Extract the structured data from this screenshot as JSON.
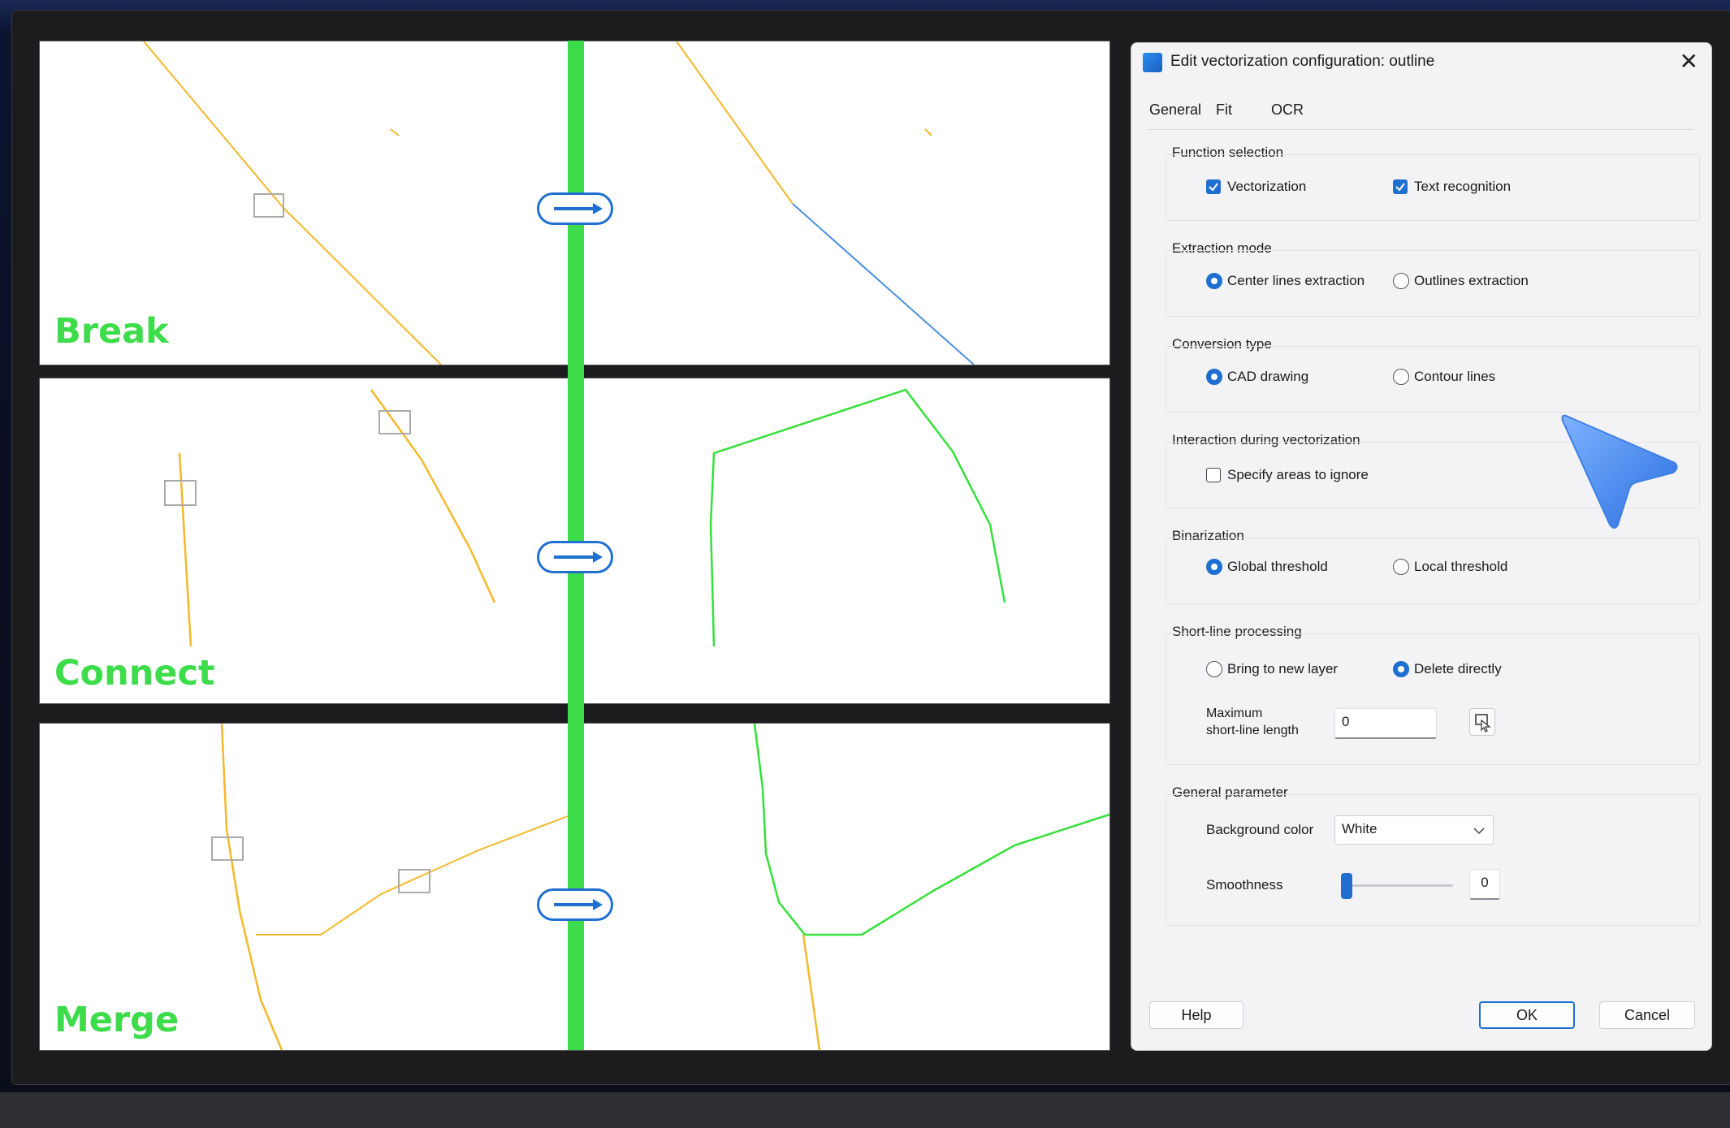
{
  "panels": [
    {
      "label": "Break"
    },
    {
      "label": "Connect"
    },
    {
      "label": "Merge"
    }
  ],
  "colors": {
    "accent_green": "#3ddc4a",
    "accent_blue": "#1f6fd1",
    "line_yellow": "#f4b82a",
    "line_blue": "#4a8fe0",
    "line_green": "#35e03a"
  },
  "dialog": {
    "title": "Edit vectorization configuration: outline",
    "close_icon": "close-icon",
    "tabs": [
      {
        "label": "General",
        "active": true
      },
      {
        "label": "Fit",
        "active": false
      },
      {
        "label": "OCR",
        "active": false
      }
    ],
    "function_selection": {
      "title": "Function selection",
      "vectorization": {
        "label": "Vectorization",
        "checked": true
      },
      "text_recognition": {
        "label": "Text recognition",
        "checked": true
      }
    },
    "extraction_mode": {
      "title": "Extraction mode",
      "center_lines": {
        "label": "Center lines extraction",
        "selected": true
      },
      "outlines": {
        "label": "Outlines extraction",
        "selected": false
      }
    },
    "conversion_type": {
      "title": "Conversion type",
      "cad_drawing": {
        "label": "CAD drawing",
        "selected": true
      },
      "contour_lines": {
        "label": "Contour lines",
        "selected": false
      }
    },
    "interaction": {
      "title": "Interaction during vectorization",
      "specify_areas": {
        "label": "Specify areas to ignore",
        "checked": false
      }
    },
    "binarization": {
      "title": "Binarization",
      "global": {
        "label": "Global threshold",
        "selected": true
      },
      "local": {
        "label": "Local threshold",
        "selected": false
      }
    },
    "short_line": {
      "title": "Short-line processing",
      "bring_to_layer": {
        "label": "Bring to new layer",
        "selected": false
      },
      "delete_directly": {
        "label": "Delete directly",
        "selected": true
      },
      "max_length_label_1": "Maximum",
      "max_length_label_2": "short-line length",
      "max_length_value": "0"
    },
    "general_parameter": {
      "title": "General parameter",
      "background_color_label": "Background color",
      "background_color_value": "White",
      "smoothness_label": "Smoothness",
      "smoothness_value": "0"
    },
    "buttons": {
      "help": "Help",
      "ok": "OK",
      "cancel": "Cancel"
    }
  }
}
